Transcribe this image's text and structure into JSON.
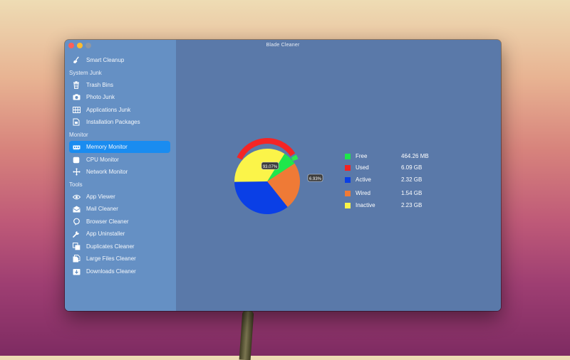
{
  "window": {
    "title": "Blade Cleaner"
  },
  "sidebar": {
    "top_item": {
      "label": "Smart Cleanup",
      "icon": "broom-icon"
    },
    "sections": [
      {
        "title": "System Junk",
        "items": [
          {
            "label": "Trash Bins",
            "icon": "trash-icon"
          },
          {
            "label": "Photo Junk",
            "icon": "camera-icon"
          },
          {
            "label": "Applications Junk",
            "icon": "grid-icon"
          },
          {
            "label": "Installation Packages",
            "icon": "package-icon"
          }
        ]
      },
      {
        "title": "Monitor",
        "items": [
          {
            "label": "Memory Monitor",
            "icon": "memory-chip-icon",
            "active": true
          },
          {
            "label": "CPU Monitor",
            "icon": "cpu-icon"
          },
          {
            "label": "Network Monitor",
            "icon": "network-icon"
          }
        ]
      },
      {
        "title": "Tools",
        "items": [
          {
            "label": "App Viewer",
            "icon": "eye-icon"
          },
          {
            "label": "Mail Cleaner",
            "icon": "mail-icon"
          },
          {
            "label": "Browser Cleaner",
            "icon": "browser-icon"
          },
          {
            "label": "App Uninstaller",
            "icon": "wrench-icon"
          },
          {
            "label": "Duplicates Cleaner",
            "icon": "duplicates-icon"
          },
          {
            "label": "Large Files Cleaner",
            "icon": "large-file-icon"
          },
          {
            "label": "Downloads Cleaner",
            "icon": "download-icon"
          }
        ]
      }
    ]
  },
  "gauge": {
    "used_percent_label": "93.07%",
    "free_percent_label": "6.93%",
    "used_fraction": 0.9307,
    "free_fraction": 0.0693,
    "used_color": "#f42525",
    "free_color": "#2ee84f"
  },
  "legend": [
    {
      "label": "Free",
      "value": "464.26 MB",
      "color": "#1fe64b"
    },
    {
      "label": "Used",
      "value": "6.09 GB",
      "color": "#f42222"
    },
    {
      "label": "Active",
      "value": "2.32 GB",
      "color": "#0a3fe6"
    },
    {
      "label": "Wired",
      "value": "1.54 GB",
      "color": "#ef7a36"
    },
    {
      "label": "Inactive",
      "value": "2.23 GB",
      "color": "#fbf449"
    }
  ],
  "chart_data": {
    "type": "pie",
    "categories": [
      "Free",
      "Active",
      "Wired",
      "Inactive"
    ],
    "values": [
      0.45,
      2.32,
      1.54,
      2.23
    ],
    "unit": "GB",
    "colors": [
      "#1fe64b",
      "#0a3fe6",
      "#ef7a36",
      "#fbf449"
    ]
  }
}
